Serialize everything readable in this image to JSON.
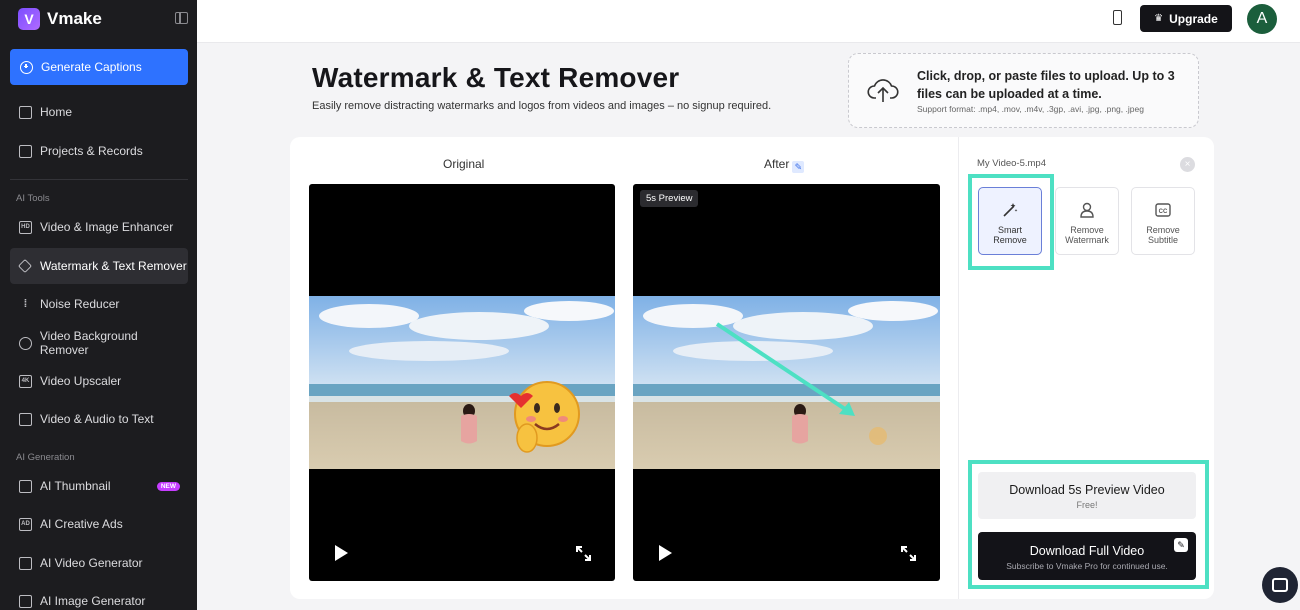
{
  "app": {
    "name": "Vmake"
  },
  "sidebar": {
    "generate_button": "Generate Captions",
    "items": [
      {
        "label": "Home",
        "icon": "home-icon"
      },
      {
        "label": "Projects & Records",
        "icon": "projects-icon"
      }
    ],
    "ai_tools_label": "AI Tools",
    "ai_tools": [
      {
        "label": "Video & Image Enhancer",
        "icon": "hd-icon"
      },
      {
        "label": "Watermark & Text Remover",
        "icon": "eraser-icon",
        "active": true
      },
      {
        "label": "Noise Reducer",
        "icon": "waveform-icon"
      },
      {
        "label": "Video Background Remover",
        "icon": "person-icon"
      },
      {
        "label": "Video Upscaler",
        "icon": "4k-icon"
      },
      {
        "label": "Video & Audio to Text",
        "icon": "text-icon"
      }
    ],
    "ai_generation_label": "AI Generation",
    "ai_generation": [
      {
        "label": "AI Thumbnail",
        "icon": "thumbnail-icon",
        "badge": "NEW"
      },
      {
        "label": "AI Creative Ads",
        "icon": "ads-icon"
      },
      {
        "label": "AI Video Generator",
        "icon": "video-gen-icon"
      },
      {
        "label": "AI Image Generator",
        "icon": "image-gen-icon"
      }
    ]
  },
  "topbar": {
    "upgrade_label": "Upgrade",
    "avatar_initial": "A"
  },
  "hero": {
    "title": "Watermark & Text Remover",
    "subtitle": "Easily remove distracting watermarks and logos from videos and images – no signup required.",
    "upload_text": "Click, drop, or paste files to upload. Up to 3 files can be uploaded at a time.",
    "formats": "Support format: .mp4, .mov, .m4v, .3gp, .avi, .jpg, .png, .jpeg"
  },
  "compare": {
    "original_label": "Original",
    "after_label": "After",
    "preview_tag": "5s Preview"
  },
  "panel": {
    "file_name": "My Video-5.mp4",
    "tools": [
      {
        "line1": "Smart",
        "line2": "Remove",
        "icon": "magic-wand-icon",
        "selected": true
      },
      {
        "line1": "Remove",
        "line2": "Watermark",
        "icon": "watermark-person-icon",
        "selected": false
      },
      {
        "line1": "Remove",
        "line2": "Subtitle",
        "icon": "cc-icon",
        "selected": false
      }
    ],
    "download_preview": {
      "label": "Download 5s Preview Video",
      "sub": "Free!"
    },
    "download_full": {
      "label": "Download Full Video",
      "sub": "Subscribe to Vmake Pro for continued use."
    }
  },
  "colors": {
    "accent": "#2e72ff",
    "highlight": "#4de0c3",
    "sidebar_bg": "#1c1c1f"
  }
}
